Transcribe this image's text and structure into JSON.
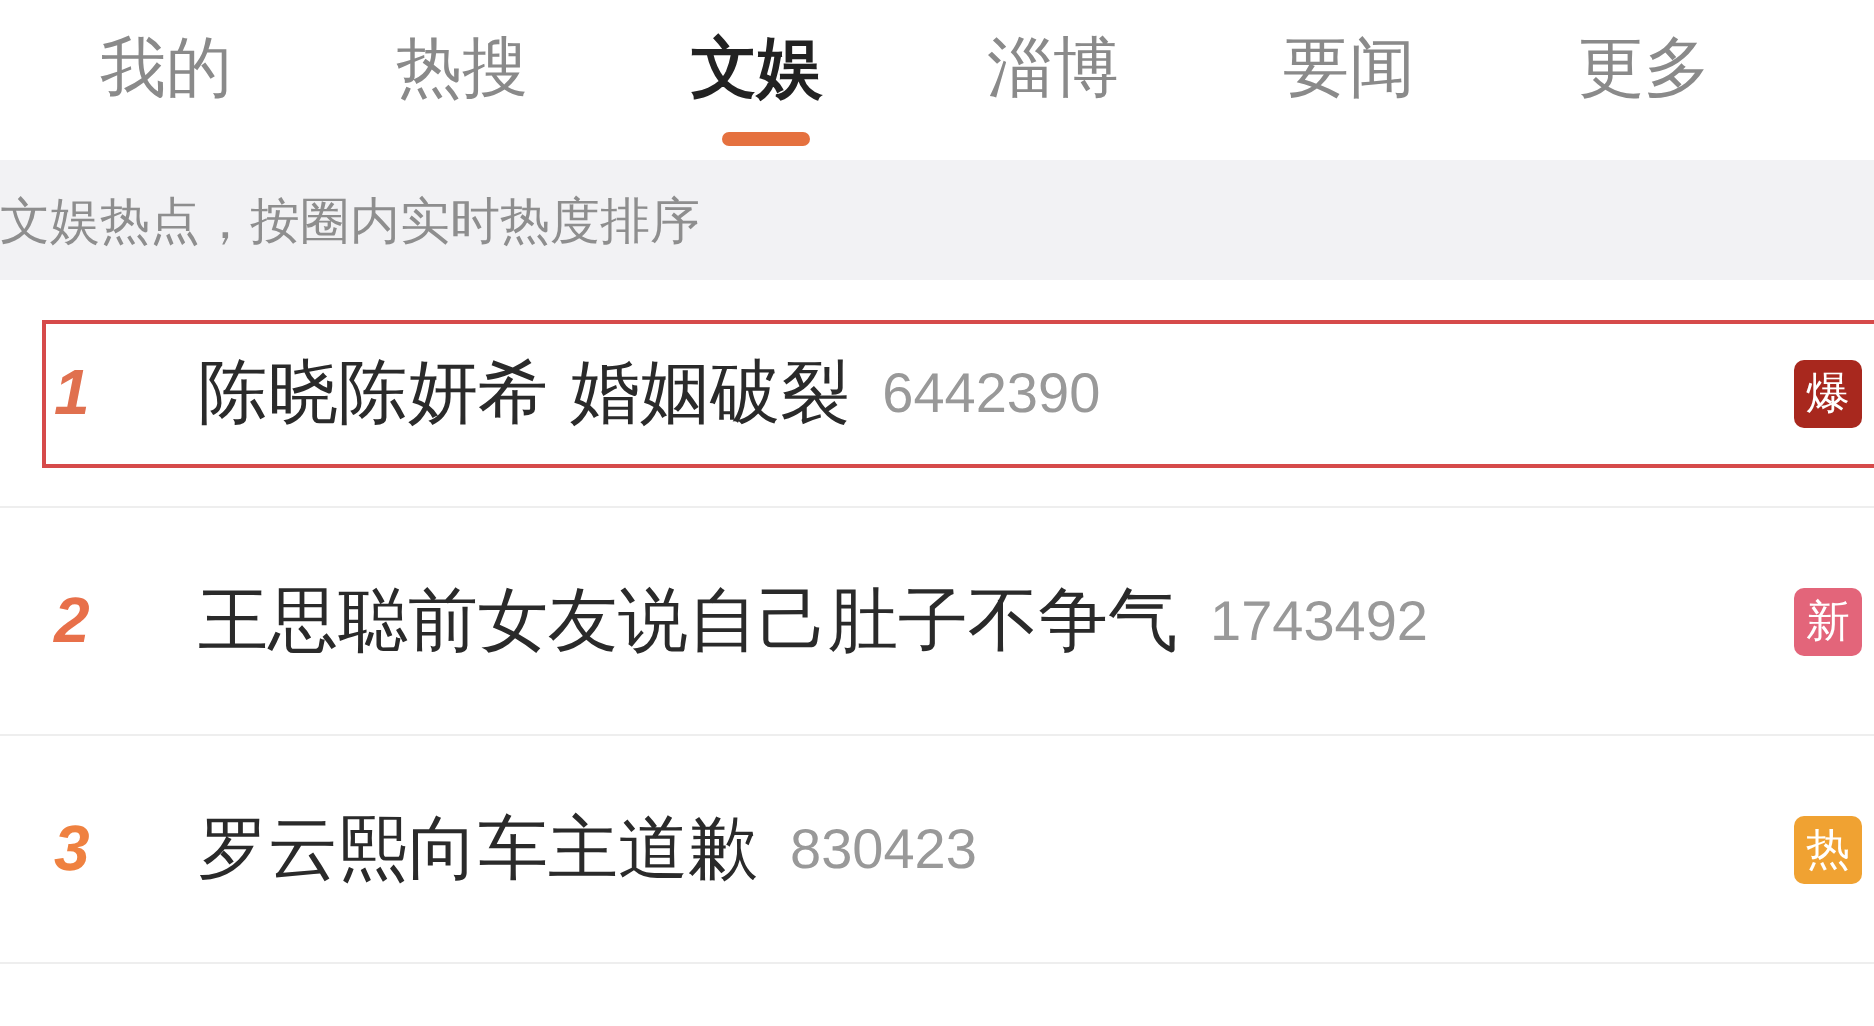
{
  "tabs": [
    {
      "label": "我的",
      "selected": false
    },
    {
      "label": "热搜",
      "selected": false
    },
    {
      "label": "文娱",
      "selected": true
    },
    {
      "label": "淄博",
      "selected": false
    },
    {
      "label": "要闻",
      "selected": false
    },
    {
      "label": "更多",
      "selected": false
    }
  ],
  "notice": "文娱热点，按圈内实时热度排序",
  "rows": [
    {
      "rank": "1",
      "title": "陈晓陈妍希 婚姻破裂",
      "count": "6442390",
      "badge": "爆",
      "color": "#a8281e",
      "selected": true
    },
    {
      "rank": "2",
      "title": "王思聪前女友说自己肚子不争气",
      "count": "1743492",
      "badge": "新",
      "color": "#e3657a",
      "selected": false
    },
    {
      "rank": "3",
      "title": "罗云熙向车主道歉",
      "count": "830423",
      "badge": "热",
      "color": "#f0a232",
      "selected": false
    }
  ]
}
